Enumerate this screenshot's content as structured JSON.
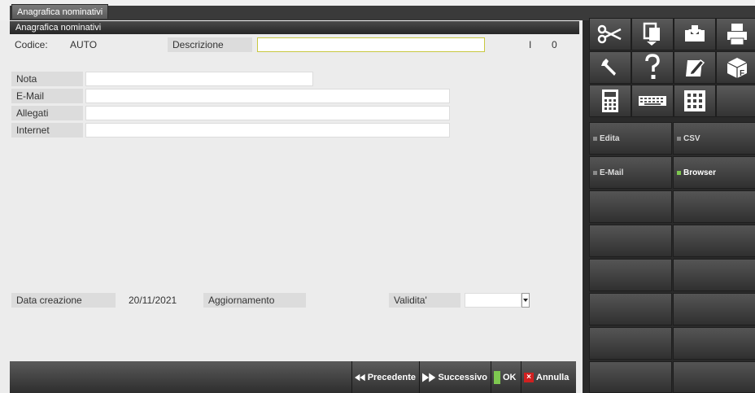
{
  "tab": {
    "label": "Anagrafica nominativi"
  },
  "form": {
    "header": "Anagrafica nominativi",
    "codice_label": "Codice:",
    "codice_value": "AUTO",
    "descrizione_label": "Descrizione",
    "descrizione_value": "",
    "flag_i": "I",
    "flag_0": "0",
    "nota_label": "Nota",
    "email_label": "E-Mail",
    "allegati_label": "Allegati",
    "internet_label": "Internet",
    "data_creazione_label": "Data creazione",
    "data_creazione_value": "20/11/2021",
    "aggiornamento_label": "Aggiornamento",
    "validita_label": "Validita'",
    "validita_value": ""
  },
  "bottom": {
    "precedente": "Precedente",
    "successivo": "Successivo",
    "ok": "OK",
    "annulla": "Annulla"
  },
  "side": {
    "edita": "Edita",
    "csv": "CSV",
    "email": "E-Mail",
    "browser": "Browser"
  },
  "icons": [
    "scissors-icon",
    "copy-doc-icon",
    "inbox-download-icon",
    "printer-icon",
    "wrench-icon",
    "help-icon",
    "edit-doc-icon",
    "f-box-icon",
    "calculator-icon",
    "keyboard-icon",
    "numpad-icon"
  ],
  "colors": {
    "active_green": "#7ec850",
    "inactive_gray": "#8a8a8a",
    "cancel_red": "#d02020"
  }
}
